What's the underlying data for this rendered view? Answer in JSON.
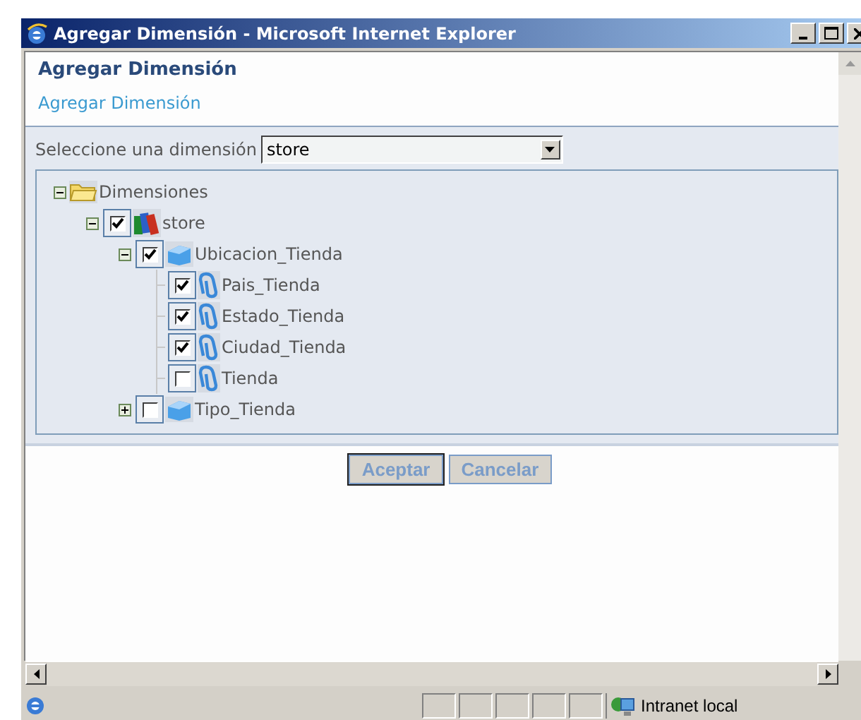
{
  "window": {
    "title": "Agregar Dimensión - Microsoft Internet Explorer"
  },
  "page": {
    "heading": "Agregar Dimensión",
    "subheading": "Agregar Dimensión"
  },
  "selector": {
    "label": "Seleccione una dimensión",
    "value": "store"
  },
  "tree": [
    {
      "label": "Dimensiones",
      "kind": "folder",
      "expanded": true,
      "children": [
        {
          "label": "store",
          "kind": "cube",
          "checked": true,
          "expanded": true,
          "children": [
            {
              "label": "Ubicacion_Tienda",
              "kind": "hierarchy",
              "checked": true,
              "expanded": true,
              "children": [
                {
                  "label": "Pais_Tienda",
                  "kind": "level",
                  "checked": true
                },
                {
                  "label": "Estado_Tienda",
                  "kind": "level",
                  "checked": true
                },
                {
                  "label": "Ciudad_Tienda",
                  "kind": "level",
                  "checked": true
                },
                {
                  "label": "Tienda",
                  "kind": "level",
                  "checked": false
                }
              ]
            },
            {
              "label": "Tipo_Tienda",
              "kind": "hierarchy",
              "checked": false,
              "expanded": false
            }
          ]
        }
      ]
    }
  ],
  "buttons": [
    {
      "label": "Aceptar",
      "focused": true
    },
    {
      "label": "Cancelar",
      "focused": false
    }
  ],
  "status_bar": {
    "zone": "Intranet local"
  }
}
